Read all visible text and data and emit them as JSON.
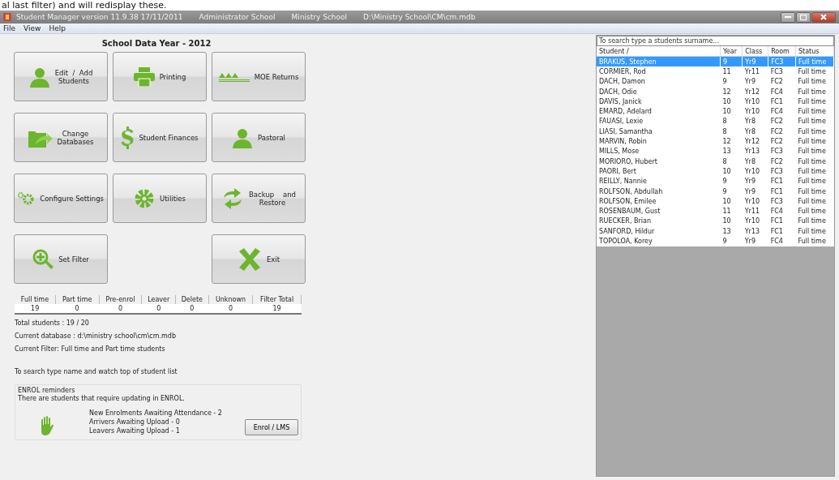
{
  "page_caption": "al last filter) and will redisplay these.",
  "window": {
    "title": "Student Manager version 11.9.38  17/11/2011",
    "title_parts": [
      "Administrator School",
      "Ministry School",
      "D:\\Ministry School\\CM\\cm.mdb"
    ]
  },
  "menu": [
    "File",
    "View",
    "Help"
  ],
  "heading": "School Data Year - 2012",
  "button_rows": [
    [
      {
        "label": "Edit  /  Add",
        "label_2": "Students"
      },
      {
        "label": "Printing"
      },
      {
        "label": "MOE Returns"
      }
    ],
    [
      {
        "label": "Change",
        "label_2": "Databases"
      },
      {
        "label": "Student Finances"
      },
      {
        "label": "Pastoral"
      }
    ],
    [
      {
        "label": "Configure Settings"
      },
      {
        "label": "Utilities"
      },
      {
        "label": "Backup    and",
        "label_2": "Restore"
      }
    ],
    [
      {
        "label": "Set Filter"
      },
      {
        "label": "Exit"
      }
    ]
  ],
  "stats": {
    "columns": [
      "Full time",
      "Part time",
      "Pre-enrol",
      "Leaver",
      "Delete",
      "Unknown",
      "Filter Total"
    ],
    "values": [
      "19",
      "0",
      "0",
      "0",
      "0",
      "0",
      "19"
    ]
  },
  "info": [
    "Total students : 19  /  20",
    "Current database : d:\\ministry school\\cm\\cm.mdb",
    "Current Filter: Full time and Part time students"
  ],
  "search_hint": "To search type name and watch top of student list",
  "enrol": {
    "title": "ENROL reminders",
    "message": "There are students that require updating in ENROL.",
    "lines": [
      "New Enrolments Awaiting Attendance - 2",
      "Arrivers Awaiting Upload - 0",
      "Leavers Awaiting Upload - 1"
    ],
    "button": "Enrol / LMS"
  },
  "student_list": {
    "search_placeholder": "To search type a students surname...",
    "columns": [
      "Student /",
      "Year",
      "Class",
      "Room",
      "Status"
    ],
    "rows": [
      {
        "cells": [
          "BRAKUS, Stephen",
          "9",
          "Yr9",
          "FC3",
          "Full time"
        ],
        "selected": true
      },
      {
        "cells": [
          "CORMIER, Rod",
          "11",
          "Yr11",
          "FC3",
          "Full time"
        ],
        "selected": false
      },
      {
        "cells": [
          "DACH, Damon",
          "9",
          "Yr9",
          "FC2",
          "Full time"
        ],
        "selected": false
      },
      {
        "cells": [
          "DACH, Odie",
          "12",
          "Yr12",
          "FC4",
          "Full time"
        ],
        "selected": false
      },
      {
        "cells": [
          "DAVIS, Janick",
          "10",
          "Yr10",
          "FC1",
          "Full time"
        ],
        "selected": false
      },
      {
        "cells": [
          "EMARD, Adelard",
          "10",
          "Yr10",
          "FC4",
          "Full time"
        ],
        "selected": false
      },
      {
        "cells": [
          "FAUASI, Lexie",
          "8",
          "Yr8",
          "FC2",
          "Full time"
        ],
        "selected": false
      },
      {
        "cells": [
          "LIASI, Samantha",
          "8",
          "Yr8",
          "FC2",
          "Full time"
        ],
        "selected": false
      },
      {
        "cells": [
          "MARVIN, Robin",
          "12",
          "Yr12",
          "FC2",
          "Full time"
        ],
        "selected": false
      },
      {
        "cells": [
          "MILLS, Mose",
          "13",
          "Yr13",
          "FC3",
          "Full time"
        ],
        "selected": false
      },
      {
        "cells": [
          "MORIORO, Hubert",
          "8",
          "Yr8",
          "FC2",
          "Full time"
        ],
        "selected": false
      },
      {
        "cells": [
          "PAORI, Bert",
          "10",
          "Yr10",
          "FC3",
          "Full time"
        ],
        "selected": false
      },
      {
        "cells": [
          "REILLY, Nannie",
          "9",
          "Yr9",
          "FC1",
          "Full time"
        ],
        "selected": false
      },
      {
        "cells": [
          "ROLFSON, Abdullah",
          "9",
          "Yr9",
          "FC1",
          "Full time"
        ],
        "selected": false
      },
      {
        "cells": [
          "ROLFSON, Emilee",
          "10",
          "Yr10",
          "FC3",
          "Full time"
        ],
        "selected": false
      },
      {
        "cells": [
          "ROSENBAUM, Gust",
          "11",
          "Yr11",
          "FC4",
          "Full time"
        ],
        "selected": false
      },
      {
        "cells": [
          "RUECKER, Brian",
          "10",
          "Yr10",
          "FC1",
          "Full time"
        ],
        "selected": false
      },
      {
        "cells": [
          "SANFORD, Hildur",
          "13",
          "Yr13",
          "FC1",
          "Full time"
        ],
        "selected": false
      },
      {
        "cells": [
          "TOPOLOA, Korey",
          "9",
          "Yr9",
          "FC4",
          "Full time"
        ],
        "selected": false
      }
    ]
  }
}
